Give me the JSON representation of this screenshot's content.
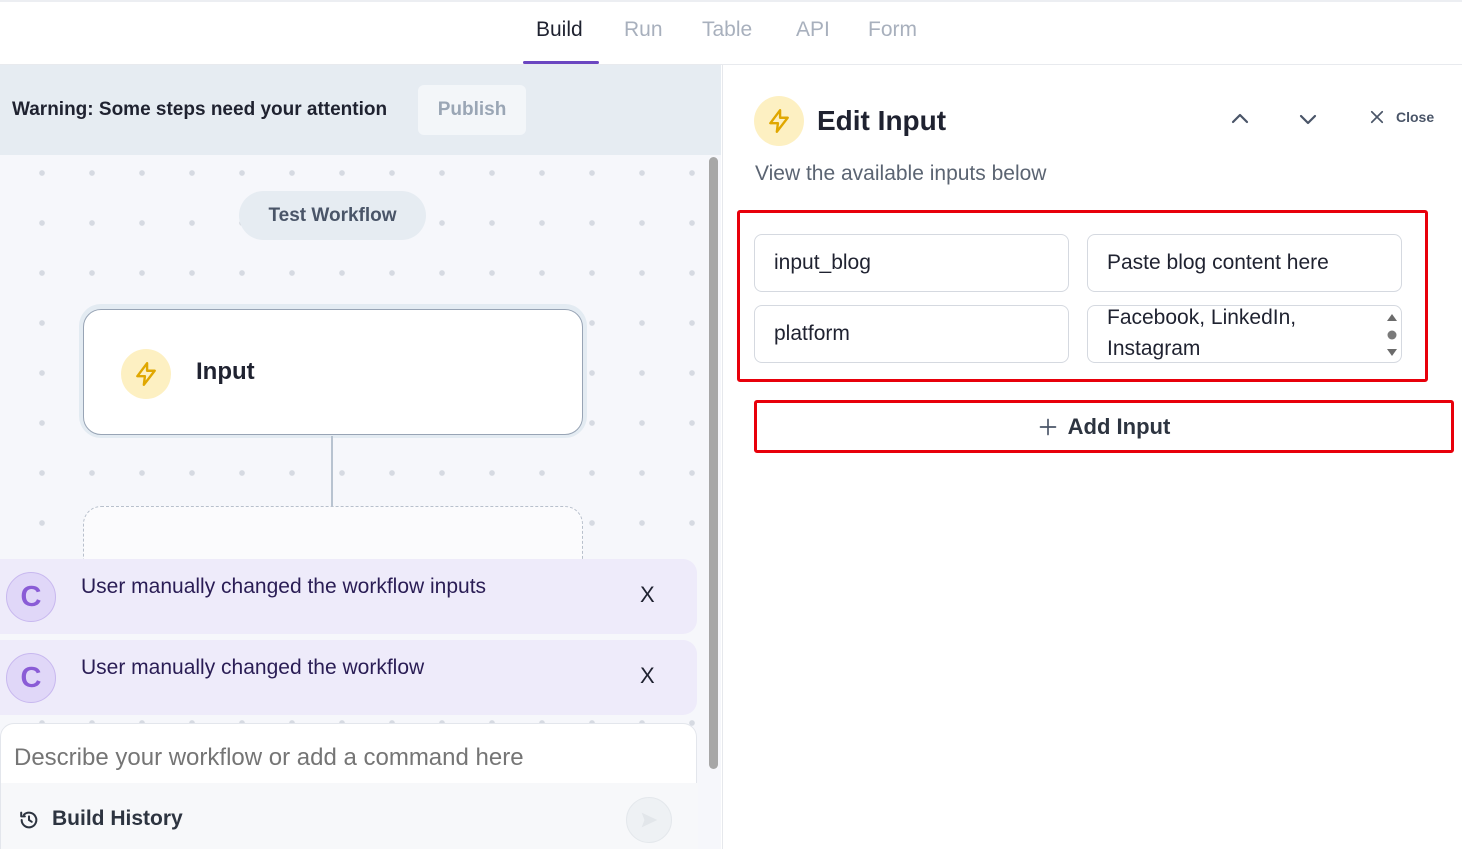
{
  "tabs": [
    {
      "label": "Build",
      "active": true
    },
    {
      "label": "Run",
      "active": false
    },
    {
      "label": "Table",
      "active": false
    },
    {
      "label": "API",
      "active": false
    },
    {
      "label": "Form",
      "active": false
    }
  ],
  "warning": {
    "text": "Warning: Some steps need your attention",
    "publish_label": "Publish"
  },
  "canvas": {
    "test_workflow_label": "Test Workflow",
    "input_node_title": "Input"
  },
  "notifications": [
    {
      "avatar": "C",
      "text": "User manually changed the workflow inputs",
      "close": "X"
    },
    {
      "avatar": "C",
      "text": "User manually changed the workflow",
      "close": "X"
    }
  ],
  "composer": {
    "placeholder": "Describe your workflow or add a command here",
    "history_label": "Build History"
  },
  "panel": {
    "title": "Edit Input",
    "close_label": "Close",
    "subtitle": "View the available inputs below",
    "inputs": [
      {
        "name": "input_blog",
        "value": "Paste blog content here"
      },
      {
        "name": "platform",
        "value": "Facebook, LinkedIn,\nInstagram"
      }
    ],
    "add_input_label": "Add Input"
  },
  "colors": {
    "accent": "#6b46c1",
    "highlight": "#e8000b",
    "icon_yellow": "#fdf0c2",
    "icon_stroke": "#e0a700"
  }
}
